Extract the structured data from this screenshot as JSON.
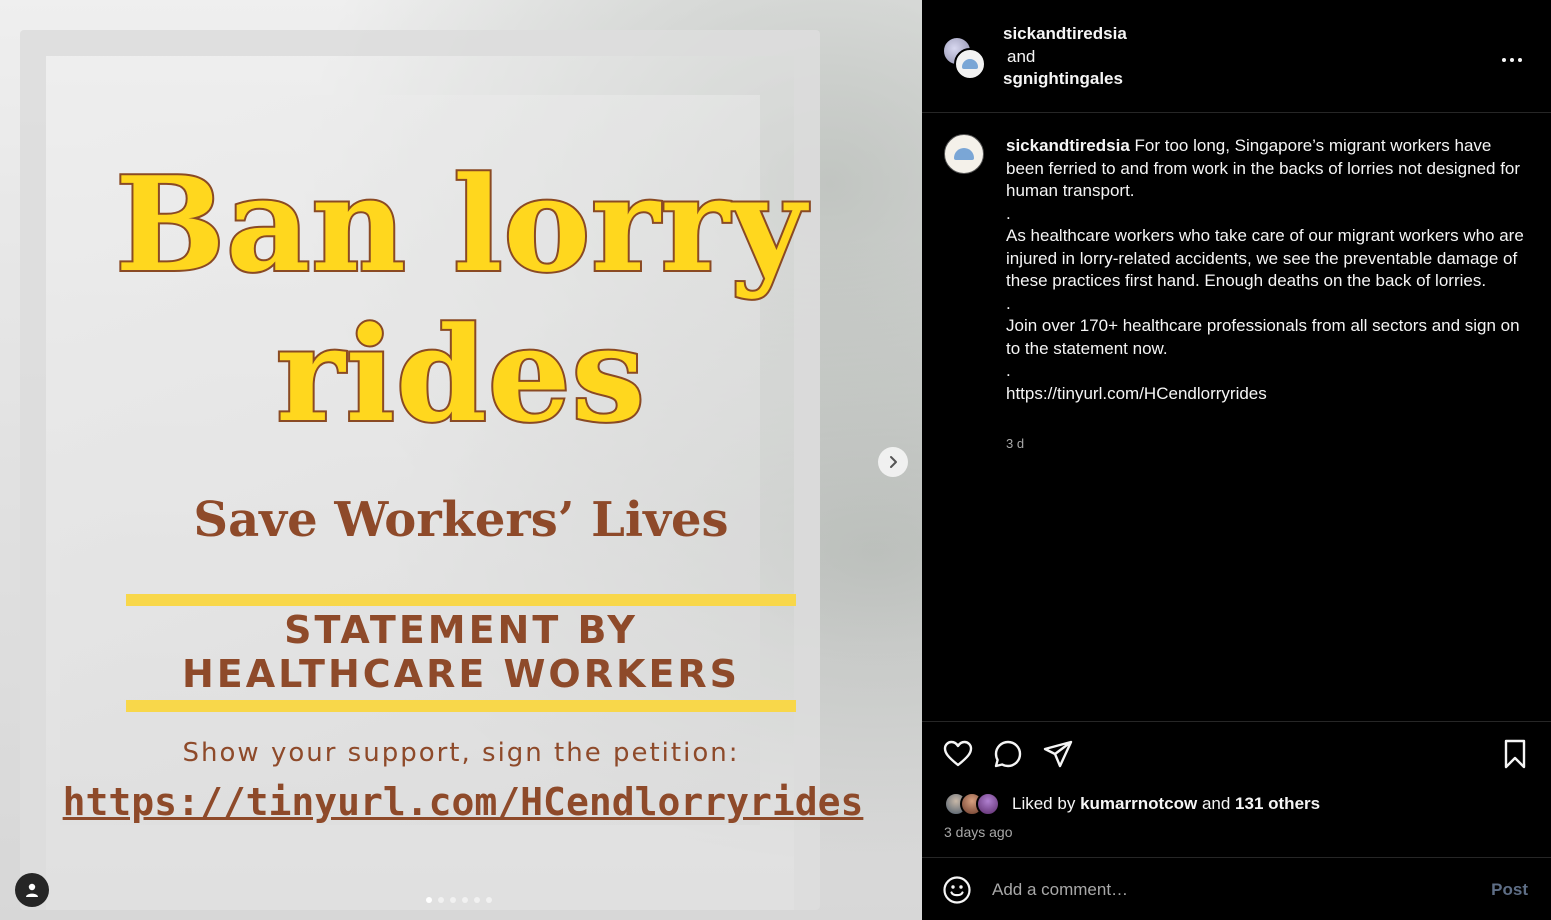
{
  "media": {
    "headline_line1": "Ban lorry",
    "headline_line2": "rides",
    "subhead": "Save Workers’ Lives",
    "statement_line1": "STATEMENT BY",
    "statement_line2": "HEALTHCARE WORKERS",
    "support_text": "Show your support, sign the petition:",
    "petition_link": "https://tinyurl.com/HCendlorryrides",
    "colors": {
      "headline": "#ffd71e",
      "outline": "#8a4a24",
      "brown_text": "#8e4a2a",
      "yellow_line": "#f8d74a"
    },
    "next_icon": "chevron-right-icon",
    "carousel_dots": 6,
    "carousel_active_index": 0
  },
  "header": {
    "account1": "sickandtiredsia",
    "connector": "and",
    "account2": "sgnightingales",
    "more_icon": "more-horizontal-icon"
  },
  "caption": {
    "username": "sickandtiredsia",
    "paragraph1": "For too long, Singapore’s migrant workers have been ferried to and from work in the backs of lorries not designed for human transport.",
    "sep1": ".",
    "paragraph2": "As healthcare workers who take care of our migrant workers who are injured in lorry-related accidents, we see the preventable damage of these practices first hand. Enough deaths on the back of lorries.",
    "sep2": ".",
    "paragraph3": "Join over 170+ healthcare professionals from all sectors and sign on to the statement now.",
    "sep3": ".",
    "link": "https://tinyurl.com/HCendlorryrides",
    "time": "3 d"
  },
  "actions": {
    "liked_prefix": "Liked by",
    "liked_user": "kumarrnotcow",
    "liked_and": "and",
    "liked_others": "131 others",
    "time_ago": "3 days ago"
  },
  "comment": {
    "placeholder": "Add a comment…",
    "post_label": "Post"
  }
}
